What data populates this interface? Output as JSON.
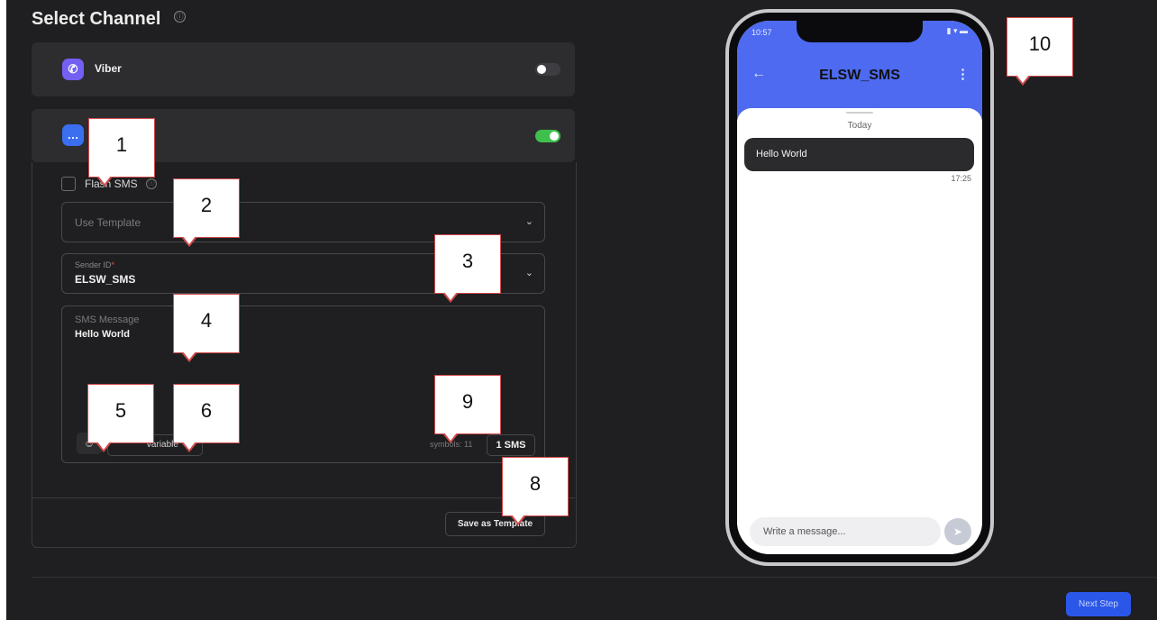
{
  "header": {
    "title": "Select Channel",
    "info_glyph": "ⓘ"
  },
  "channels": {
    "viber": {
      "label": "Viber",
      "enabled": false
    },
    "sms": {
      "enabled": true
    }
  },
  "sms_form": {
    "flash_label": "Flash SMS",
    "template_placeholder": "Use Template",
    "sender_label": "Sender ID",
    "sender_required_mark": "*",
    "sender_value": "ELSW_SMS",
    "message_label": "SMS Message",
    "message_value": "Hello World",
    "variable_button_fragment": "Variable",
    "symbols_text": "symbols: 11",
    "sms_count": "1 SMS",
    "save_template_label": "Save as Template"
  },
  "footer": {
    "next_label": "Next Step"
  },
  "phone_preview": {
    "status_time": "10:57",
    "sender_title": "ELSW_SMS",
    "date_divider": "Today",
    "message_text": "Hello World",
    "message_time": "17:25",
    "input_placeholder": "Write a message..."
  },
  "annotations": [
    "1",
    "2",
    "3",
    "4",
    "5",
    "6",
    "8",
    "9",
    "10"
  ],
  "colors": {
    "accent": "#2b57e8",
    "toggle_on": "#3fc04d",
    "phone_header": "#4d6af0",
    "callout_border": "#d24a4a"
  }
}
